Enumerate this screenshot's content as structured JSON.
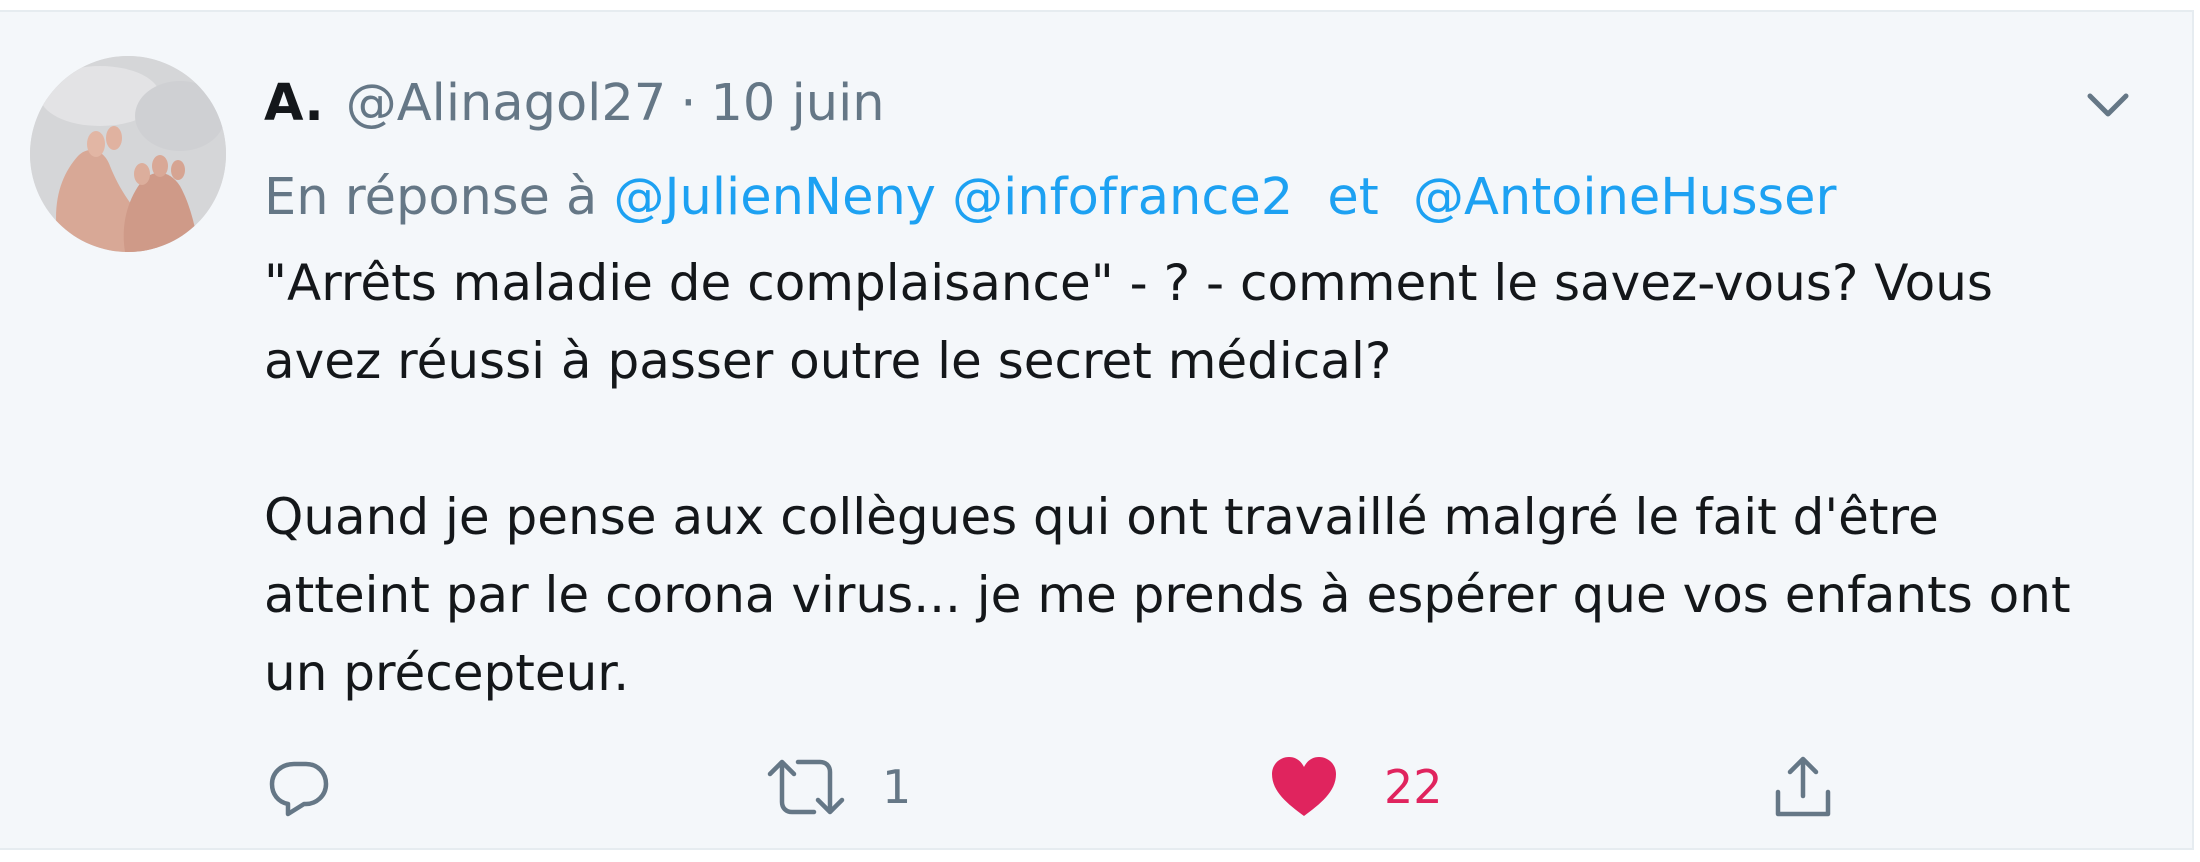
{
  "tweet": {
    "author_name": "A.",
    "handle": "@Alinagol27",
    "separator": "·",
    "date": "10 juin",
    "reply_prefix": "En réponse à",
    "mentions": [
      "@JulienNeny",
      "@infofrance2",
      "@AntoineHusser"
    ],
    "mention_conjunction": "et",
    "body_lines_para1": [
      "\"Arrêts maladie de complaisance\" - ? - comment le savez-vous? Vous",
      "avez réussi à passer outre le secret médical?"
    ],
    "body_lines_para2": [
      "Quand je pense aux collègues qui ont travaillé malgré le fait d'être",
      "atteint par le corona virus... je me prends à espérer que vos enfants ont",
      "un précepteur."
    ]
  },
  "actions": {
    "reply_icon": "reply-icon",
    "retweet_icon": "retweet-icon",
    "retweet_count": "1",
    "like_icon": "heart-icon",
    "like_count": "22",
    "like_color": "#e0245e",
    "share_icon": "share-icon"
  },
  "colors": {
    "accent": "#1da1f2",
    "secondary_text": "#657786",
    "background": "#f4f7fa"
  }
}
